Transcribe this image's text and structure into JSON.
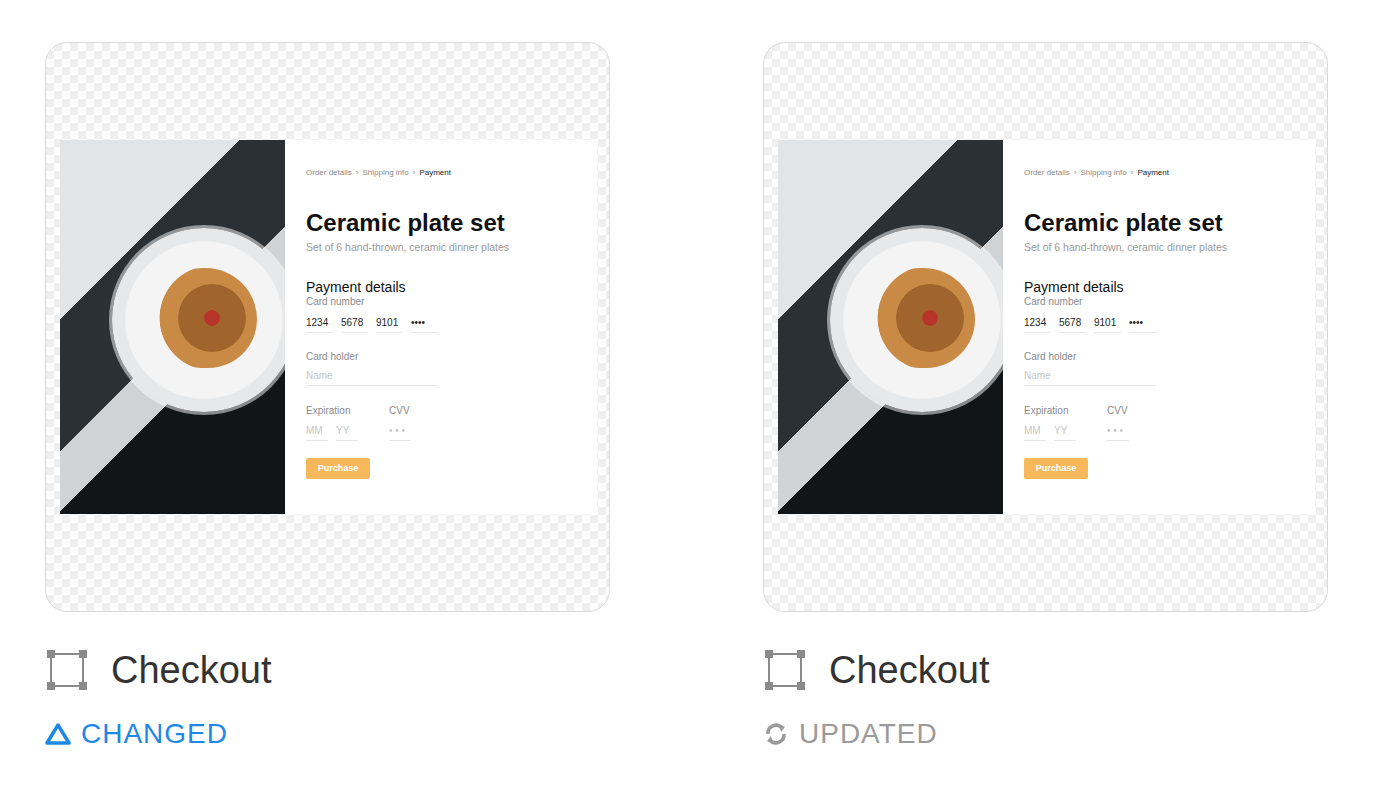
{
  "frames": [
    {
      "name": "Checkout",
      "status": {
        "label": "CHANGED",
        "kind": "changed",
        "color": "#1e88e5"
      },
      "preview": {
        "breadcrumb": [
          {
            "label": "Order details",
            "selected": false
          },
          {
            "label": "Shipping info",
            "selected": false
          },
          {
            "label": "Payment",
            "selected": true
          }
        ],
        "separator": "›",
        "title": "Ceramic plate set",
        "subtitle": "Set of 6 hand-thrown, ceramic dinner plates",
        "section": "Payment details",
        "card_number": {
          "label": "Card number",
          "groups": [
            "1234",
            "5678",
            "9101",
            "••••"
          ]
        },
        "card_holder": {
          "label": "Card holder",
          "placeholder": "Name"
        },
        "expiration": {
          "label": "Expiration",
          "month_placeholder": "MM",
          "year_placeholder": "YY"
        },
        "cvv": {
          "label": "CVV",
          "placeholder": "• • •"
        },
        "button": "Purchase"
      }
    },
    {
      "name": "Checkout",
      "status": {
        "label": "UPDATED",
        "kind": "updated",
        "color": "#9a9a9a"
      },
      "preview": {
        "breadcrumb": [
          {
            "label": "Order details",
            "selected": false
          },
          {
            "label": "Shipping info",
            "selected": false
          },
          {
            "label": "Payment",
            "selected": true
          }
        ],
        "separator": "›",
        "title": "Ceramic plate set",
        "subtitle": "Set of 6 hand-thrown, ceramic dinner plates",
        "section": "Payment details",
        "card_number": {
          "label": "Card number",
          "groups": [
            "1234",
            "5678",
            "9101",
            "••••"
          ]
        },
        "card_holder": {
          "label": "Card holder",
          "placeholder": "Name"
        },
        "expiration": {
          "label": "Expiration",
          "month_placeholder": "MM",
          "year_placeholder": "YY"
        },
        "cvv": {
          "label": "CVV",
          "placeholder": "• • •"
        },
        "button": "Purchase"
      }
    }
  ]
}
